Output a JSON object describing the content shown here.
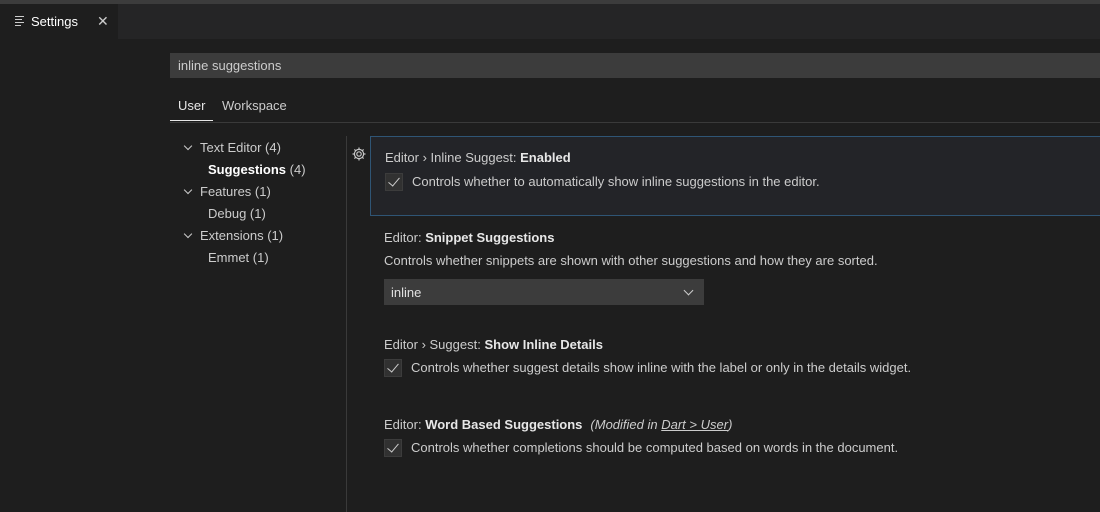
{
  "tab": {
    "title": "Settings",
    "icon": "settings-list-icon",
    "close": "✕"
  },
  "search": {
    "value": "inline suggestions"
  },
  "scope_tabs": [
    {
      "label": "User",
      "active": true
    },
    {
      "label": "Workspace",
      "active": false
    }
  ],
  "toc": [
    {
      "label": "Text Editor (4)",
      "expanded": true,
      "level": 0
    },
    {
      "label": "Suggestions",
      "count": "(4)",
      "level": 1,
      "selected": true
    },
    {
      "label": "Features (1)",
      "expanded": true,
      "level": 0
    },
    {
      "label": "Debug (1)",
      "level": 1
    },
    {
      "label": "Extensions (1)",
      "expanded": true,
      "level": 0
    },
    {
      "label": "Emmet (1)",
      "level": 1
    }
  ],
  "settings": [
    {
      "category": "Editor › Inline Suggest: ",
      "name": "Enabled",
      "description": "Controls whether to automatically show inline suggestions in the editor.",
      "checked": true
    },
    {
      "category": "Editor: ",
      "name": "Snippet Suggestions",
      "description": "Controls whether snippets are shown with other suggestions and how they are sorted.",
      "value": "inline"
    },
    {
      "category": "Editor › Suggest: ",
      "name": "Show Inline Details",
      "description": "Controls whether suggest details show inline with the label or only in the details widget.",
      "checked": true
    },
    {
      "category": "Editor: ",
      "name": "Word Based Suggestions",
      "modified_prefix": "(Modified in ",
      "modified_link": "Dart > User",
      "modified_suffix": ")",
      "description": "Controls whether completions should be computed based on words in the document.",
      "checked": true
    }
  ],
  "colors": {
    "background": "#1e1e1e",
    "focus_border": "#2f5575",
    "input_bg": "#3c3c3c"
  }
}
